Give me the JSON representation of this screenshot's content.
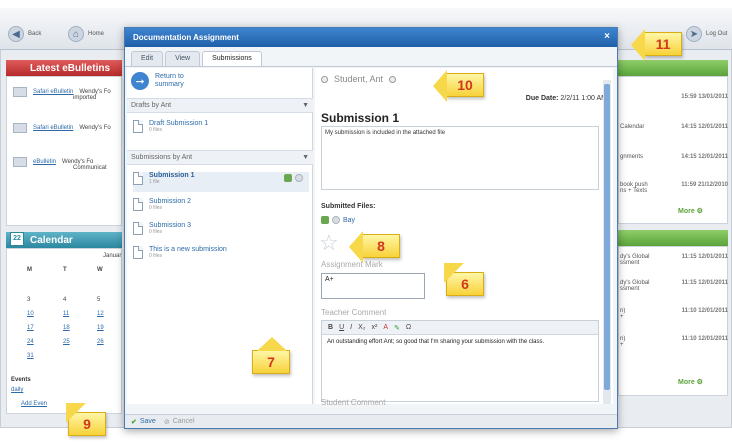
{
  "background_app": {
    "back_label": "Back",
    "home_label": "Home",
    "logout_label": "Log Out",
    "bulletins": {
      "title": "Latest eBulletins",
      "rows": [
        {
          "link": "Safari eBulletin",
          "author": "Wendy's Fo",
          "note": "imported"
        },
        {
          "link": "Safari eBulletin",
          "author": "Wendy's Fo",
          "note": ""
        },
        {
          "link": "eBulletin",
          "author": "Wendy's Fo",
          "note": "Communicat"
        }
      ]
    },
    "calendar": {
      "title": "Calendar",
      "icon_day": "22",
      "month": "Januar",
      "weekdays": [
        "M",
        "T",
        "W"
      ],
      "dates": [
        [
          "3",
          "4",
          "5"
        ],
        [
          "10",
          "11",
          "12"
        ],
        [
          "17",
          "18",
          "19"
        ],
        [
          "24",
          "25",
          "26"
        ],
        [
          "31",
          "",
          ""
        ]
      ],
      "events_label": "Events",
      "events_link": "daily",
      "add_event": "Add Even"
    },
    "right_panel_rows": [
      {
        "label": "",
        "time": "15:59",
        "date": "13/01/2011"
      },
      {
        "label": "Calendar",
        "time": "14:15",
        "date": "12/01/2011"
      },
      {
        "label": "gnments",
        "time": "14:15",
        "date": "12/01/2011"
      },
      {
        "label": "book push\nns + Texts",
        "time": "11:59",
        "date": "21/12/2010"
      }
    ],
    "right_panel_rows_2": [
      {
        "label": "dy's Global\nssment",
        "time": "11:15",
        "date": "12/01/2011"
      },
      {
        "label": "dy's Global\nssment",
        "time": "11:15",
        "date": "12/01/2011"
      },
      {
        "label": "n)\n+",
        "time": "11:10",
        "date": "12/01/2011"
      },
      {
        "label": "n)\n+",
        "time": "11:10",
        "date": "12/01/2011"
      }
    ],
    "more_label": "More"
  },
  "modal": {
    "title": "Documentation Assignment",
    "close": "×",
    "tabs": [
      "Edit",
      "View",
      "Submissions"
    ],
    "return_label": "Return to summary",
    "drafts_header": "Drafts by Ant",
    "drafts": [
      {
        "title": "Draft Submission 1",
        "sub": "0 files"
      }
    ],
    "submissions_header": "Submissions by Ant",
    "submissions": [
      {
        "title": "Submission 1",
        "sub": "1 file",
        "selected": true
      },
      {
        "title": "Submission 2",
        "sub": "0 files",
        "selected": false
      },
      {
        "title": "Submission 3",
        "sub": "0 files",
        "selected": false
      },
      {
        "title": "This is a new submission",
        "sub": "0 files",
        "selected": false
      }
    ],
    "student_name": "Student, Ant",
    "due_label": "Due Date:",
    "due_value": "2/2/11 1:00 AM",
    "submission_title": "Submission 1",
    "submission_text": "My submission is included in the attached file",
    "submitted_files_label": "Submitted Files:",
    "file_name": "Bay",
    "assignment_mark_label": "Assignment Mark",
    "assignment_mark_value": "A+",
    "teacher_comment_label": "Teacher Comment",
    "editor_tools": [
      "B",
      "U",
      "I",
      "X₂",
      "x²",
      "A",
      "✎",
      "Ω"
    ],
    "teacher_comment_text": "An outstanding effort Ant; so good that I'm sharing your submission with the class.",
    "student_comment_label": "Student Comment",
    "save_label": "Save",
    "cancel_label": "Cancel"
  },
  "callouts": [
    "6",
    "7",
    "8",
    "9",
    "10",
    "11"
  ],
  "colors": {
    "accent": "#1f5fa9",
    "callout_fill": "#f7d23a",
    "callout_text": "#d2381d"
  }
}
